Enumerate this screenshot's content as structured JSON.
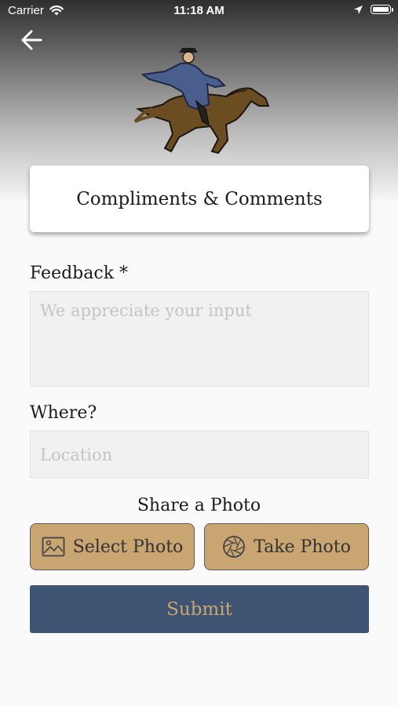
{
  "status_bar": {
    "carrier": "Carrier",
    "time": "11:18 AM"
  },
  "header": {
    "title": "Compliments & Comments"
  },
  "form": {
    "feedback_label": "Feedback *",
    "feedback_placeholder": "We appreciate your input",
    "feedback_value": "",
    "where_label": "Where?",
    "location_placeholder": "Location",
    "location_value": "",
    "share_label": "Share a Photo",
    "select_photo_label": "Select Photo",
    "take_photo_label": "Take Photo",
    "submit_label": "Submit"
  },
  "icons": {
    "back": "arrow-left-icon",
    "wifi": "wifi-icon",
    "location": "location-arrow-icon",
    "battery": "battery-icon",
    "select_photo": "image-icon",
    "take_photo": "camera-aperture-icon"
  },
  "colors": {
    "accent_tan": "#c9a572",
    "submit_navy": "#3e5472",
    "field_bg": "#f1f1f1"
  }
}
